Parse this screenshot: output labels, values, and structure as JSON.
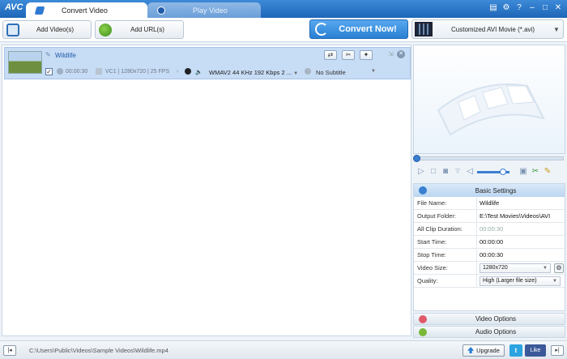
{
  "app": {
    "logo": "AVC"
  },
  "tabs": [
    {
      "label": "Convert Video"
    },
    {
      "label": "Play Video"
    }
  ],
  "toolbar": {
    "add_video_label": "Add Video(s)",
    "add_url_label": "Add URL(s)",
    "convert_label": "Convert Now!",
    "profile_label": "Customized AVI Movie (*.avi)"
  },
  "file": {
    "title": "Wildlife",
    "duration": "00:00:30",
    "video_info": "VC1 | 1280x720 | 25 FPS",
    "audio_track": "WMAV2 44 KHz 192 Kbps 2 ...",
    "subtitle": "No Subtitle",
    "checked": true
  },
  "settings": {
    "header": "Basic Settings",
    "rows": [
      {
        "key": "File Name:",
        "value": "Wildlife"
      },
      {
        "key": "Output Folder:",
        "value": "E:\\Test Movies\\Videos\\AVI"
      },
      {
        "key": "All Clip Duration:",
        "value": "00:00:30"
      },
      {
        "key": "Start Time:",
        "value": "00:00:00"
      },
      {
        "key": "Stop Time:",
        "value": "00:00:30"
      },
      {
        "key": "Video Size:",
        "value": "1280x720"
      },
      {
        "key": "Quality:",
        "value": "High (Larger file size)"
      }
    ],
    "video_options": "Video Options",
    "audio_options": "Audio Options"
  },
  "status": {
    "path": "C:\\Users\\Public\\Videos\\Sample Videos\\Wildlife.mp4",
    "upgrade_label": "Upgrade",
    "like_label": "Like",
    "twitter_label": "t"
  },
  "colors": {
    "accent": "#2a7fd3",
    "selection": "#c7dcf5",
    "titlebar": "#1e66b8"
  },
  "icons": {
    "tab_convert": "convert-tab-icon",
    "tab_play": "play-tab-icon",
    "add_video": "add-video-icon",
    "add_url": "add-url-icon",
    "convert": "refresh-icon",
    "profile": "film-strip-icon"
  }
}
